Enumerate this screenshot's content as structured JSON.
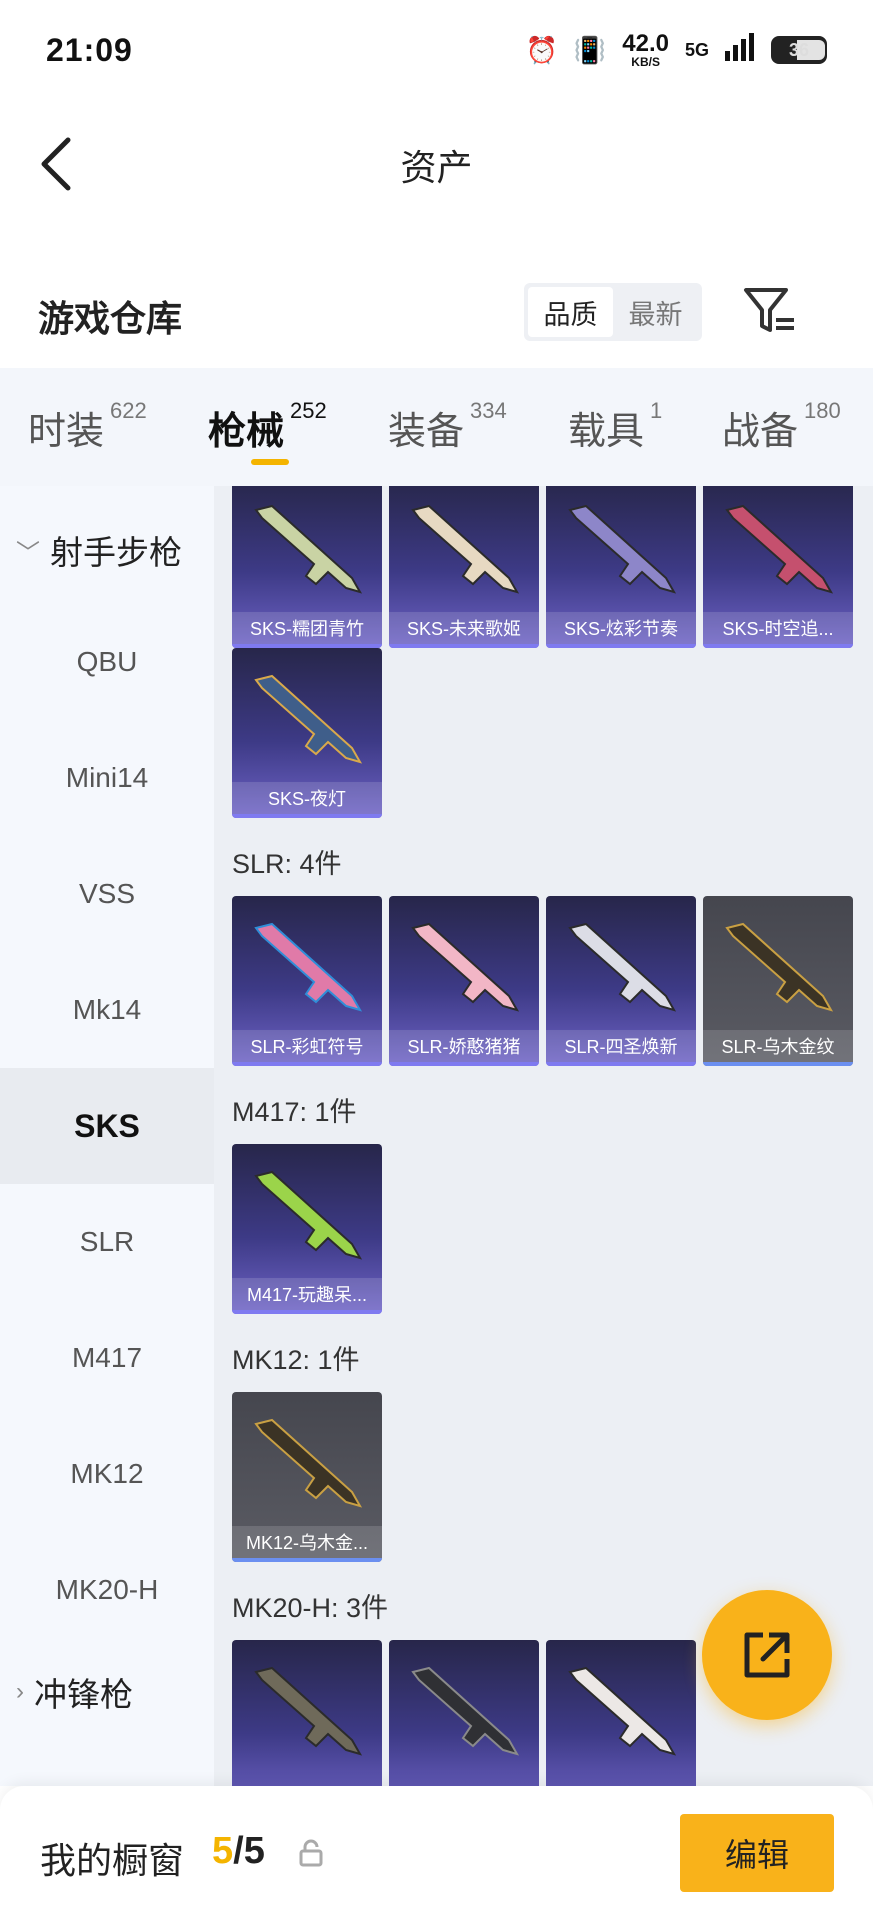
{
  "status_bar": {
    "time": "21:09",
    "net_speed": "42.0",
    "net_unit": "KB/S",
    "signal": "5G",
    "battery": "36"
  },
  "header": {
    "title": "资产"
  },
  "warehouse": {
    "title": "游戏仓库",
    "sort_options": [
      "品质",
      "最新"
    ],
    "active_sort": "品质"
  },
  "tabs": [
    {
      "label": "时装",
      "count": "622"
    },
    {
      "label": "枪械",
      "count": "252",
      "active": true
    },
    {
      "label": "装备",
      "count": "334"
    },
    {
      "label": "载具",
      "count": "1"
    },
    {
      "label": "战备",
      "count": "180"
    }
  ],
  "sidebar": {
    "category_open": "射手步枪",
    "items": [
      "QBU",
      "Mini14",
      "VSS",
      "Mk14",
      "SKS",
      "SLR",
      "M417",
      "MK12",
      "MK20-H"
    ],
    "active_item": "SKS",
    "category_closed": "冲锋枪"
  },
  "content": {
    "sks_items": [
      "SKS-糯团青竹",
      "SKS-未来歌姬",
      "SKS-炫彩节奏",
      "SKS-时空追...",
      "SKS-夜灯"
    ],
    "slr_label": "SLR: 4件",
    "slr_items": [
      "SLR-彩虹符号",
      "SLR-娇憨猪猪",
      "SLR-四圣焕新",
      "SLR-乌木金纹"
    ],
    "m417_label": "M417: 1件",
    "m417_items": [
      "M417-玩趣呆..."
    ],
    "mk12_label": "MK12: 1件",
    "mk12_items": [
      "MK12-乌木金..."
    ],
    "mk20_label": "MK20-H: 3件"
  },
  "bottom_bar": {
    "label": "我的橱窗",
    "current": "5",
    "separator": "/",
    "total": "5",
    "edit_label": "编辑"
  },
  "colors": {
    "accent": "#f9b21a",
    "card_purple": "#3d3a86",
    "card_gray": "#55565e"
  }
}
